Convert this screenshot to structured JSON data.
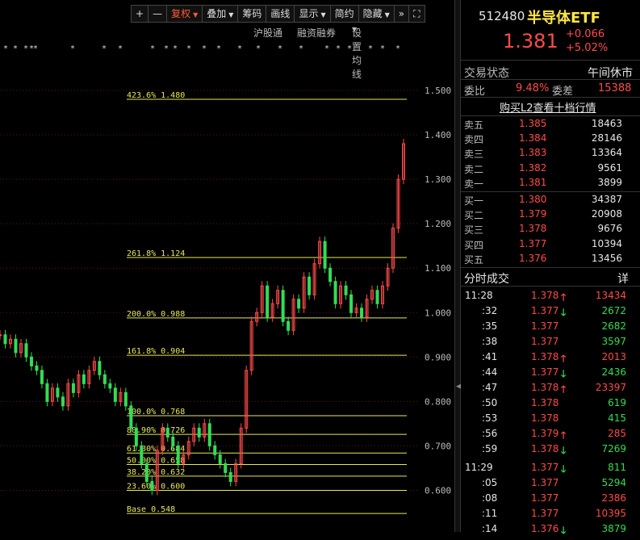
{
  "toolbar": {
    "plus": "+",
    "minus": "—",
    "fuquan": "复权",
    "diejia": "叠加",
    "chouma": "筹码",
    "huaxian": "画线",
    "xianshi": "显示",
    "jianyue": "简约",
    "yincang": "隐藏",
    "more": "»",
    "fullscreen": "⛶"
  },
  "subbar": {
    "hgt": "沪股通",
    "rzrq": "融资融券",
    "settings": "设置均线"
  },
  "chart_data": {
    "type": "line",
    "y_ticks": [
      "1.500",
      "1.400",
      "1.300",
      "1.200",
      "1.100",
      "1.000",
      "0.900",
      "0.800",
      "0.700",
      "0.600"
    ],
    "ylim": [
      0.548,
      1.585
    ],
    "fib_levels": [
      {
        "label": "423.6%",
        "price": "1.480",
        "value": 1.48
      },
      {
        "label": "261.8%",
        "price": "1.124",
        "value": 1.124
      },
      {
        "label": "200.0%",
        "price": "0.988",
        "value": 0.988
      },
      {
        "label": "161.8%",
        "price": "0.904",
        "value": 0.904
      },
      {
        "label": "100.0%",
        "price": "0.768",
        "value": 0.768
      },
      {
        "label": "80.90%",
        "price": "0.726",
        "value": 0.726
      },
      {
        "label": "61.80%",
        "price": "0.684",
        "value": 0.684
      },
      {
        "label": "50.00%",
        "price": "0.658",
        "value": 0.658
      },
      {
        "label": "38.20%",
        "price": "0.632",
        "value": 0.632
      },
      {
        "label": "23.60%",
        "price": "0.600",
        "value": 0.6
      },
      {
        "label": "Base",
        "price": "0.548",
        "value": 0.548
      }
    ],
    "price_series": [
      0.95,
      0.93,
      0.94,
      0.91,
      0.93,
      0.9,
      0.88,
      0.87,
      0.84,
      0.8,
      0.83,
      0.81,
      0.79,
      0.84,
      0.82,
      0.86,
      0.84,
      0.87,
      0.89,
      0.86,
      0.84,
      0.83,
      0.8,
      0.82,
      0.79,
      0.74,
      0.7,
      0.66,
      0.62,
      0.6,
      0.69,
      0.74,
      0.72,
      0.7,
      0.66,
      0.68,
      0.71,
      0.74,
      0.72,
      0.75,
      0.7,
      0.68,
      0.66,
      0.64,
      0.62,
      0.66,
      0.74,
      0.87,
      0.98,
      1.0,
      1.06,
      0.99,
      1.02,
      1.05,
      0.98,
      0.96,
      1.03,
      1.01,
      1.08,
      1.04,
      1.11,
      1.16,
      1.1,
      1.07,
      1.02,
      1.06,
      1.04,
      1.0,
      1.01,
      0.99,
      1.03,
      1.05,
      1.02,
      1.06,
      1.1,
      1.19,
      1.3,
      1.38
    ]
  },
  "quote": {
    "code": "512480",
    "name": "半导体ETF",
    "price": "1.381",
    "change": "+0.066",
    "pct": "+5.02%"
  },
  "status": {
    "label": "交易状态",
    "value": "午间休市"
  },
  "weibi": {
    "label": "委比",
    "value": "9.48%",
    "diff_label": "委差",
    "diff_value": "15388"
  },
  "l2_link": "购买L2查看十档行情",
  "sells": [
    {
      "label": "卖五",
      "price": "1.385",
      "vol": "18463"
    },
    {
      "label": "卖四",
      "price": "1.384",
      "vol": "28146"
    },
    {
      "label": "卖三",
      "price": "1.383",
      "vol": "13364"
    },
    {
      "label": "卖二",
      "price": "1.382",
      "vol": "9561"
    },
    {
      "label": "卖一",
      "price": "1.381",
      "vol": "3899"
    }
  ],
  "buys": [
    {
      "label": "买一",
      "price": "1.380",
      "vol": "34387"
    },
    {
      "label": "买二",
      "price": "1.379",
      "vol": "20908"
    },
    {
      "label": "买三",
      "price": "1.378",
      "vol": "9676"
    },
    {
      "label": "买四",
      "price": "1.377",
      "vol": "10394"
    },
    {
      "label": "买五",
      "price": "1.376",
      "vol": "13456"
    }
  ],
  "ticks_header": {
    "title": "分时成交",
    "detail": "详"
  },
  "ticks": [
    {
      "time": "11:28",
      "price": "1.378",
      "dir": "up",
      "vol": "13434",
      "vcolor": "red"
    },
    {
      "time": ":32",
      "price": "1.377",
      "dir": "down",
      "vol": "2672",
      "vcolor": "green"
    },
    {
      "time": ":35",
      "price": "1.377",
      "dir": "",
      "vol": "2682",
      "vcolor": "green"
    },
    {
      "time": ":38",
      "price": "1.377",
      "dir": "",
      "vol": "3597",
      "vcolor": "green"
    },
    {
      "time": ":41",
      "price": "1.378",
      "dir": "up",
      "vol": "2013",
      "vcolor": "red"
    },
    {
      "time": ":44",
      "price": "1.377",
      "dir": "down",
      "vol": "2436",
      "vcolor": "green"
    },
    {
      "time": ":47",
      "price": "1.378",
      "dir": "up",
      "vol": "23397",
      "vcolor": "red"
    },
    {
      "time": ":50",
      "price": "1.378",
      "dir": "",
      "vol": "619",
      "vcolor": "green"
    },
    {
      "time": ":53",
      "price": "1.378",
      "dir": "",
      "vol": "415",
      "vcolor": "green"
    },
    {
      "time": ":56",
      "price": "1.379",
      "dir": "up",
      "vol": "285",
      "vcolor": "red"
    },
    {
      "time": ":59",
      "price": "1.378",
      "dir": "down",
      "vol": "7269",
      "vcolor": "green"
    },
    {
      "time": "11:29",
      "price": "1.377",
      "dir": "down",
      "vol": "811",
      "vcolor": "green"
    },
    {
      "time": ":05",
      "price": "1.377",
      "dir": "",
      "vol": "5294",
      "vcolor": "green"
    },
    {
      "time": ":08",
      "price": "1.377",
      "dir": "",
      "vol": "2386",
      "vcolor": "red"
    },
    {
      "time": ":11",
      "price": "1.377",
      "dir": "",
      "vol": "10395",
      "vcolor": "red"
    },
    {
      "time": ":14",
      "price": "1.376",
      "dir": "down",
      "vol": "3879",
      "vcolor": "green"
    }
  ],
  "colors": {
    "up": "#ff4a4a",
    "down": "#33dd55",
    "fib": "#e8e85a",
    "grid": "#6b1f1f"
  }
}
